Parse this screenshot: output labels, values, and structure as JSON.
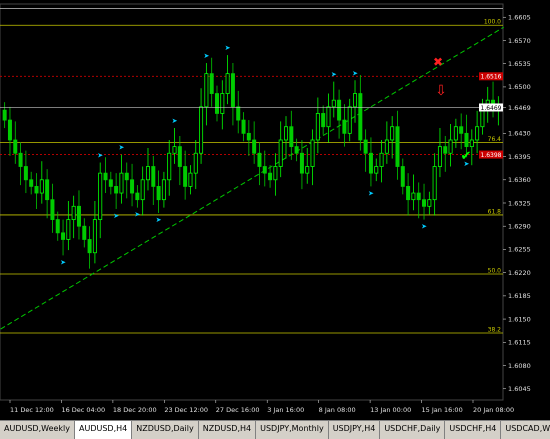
{
  "colors": {
    "background": "#000000",
    "bull": "#00ff00",
    "bear": "#00cc00",
    "fractal": "#00ccff",
    "fib": "#c8c800",
    "red_level": "#cc0000",
    "trend": "#00c800",
    "white_line": "#c8c8c8"
  },
  "chart_data": {
    "type": "candlestick",
    "symbol": "AUDUSD,H4",
    "ylim": [
      1.6028,
      1.6625
    ],
    "y_ticks": [
      "1.6605",
      "1.6570",
      "1.6535",
      "1.6500",
      "1.6469",
      "1.6430",
      "1.6395",
      "1.6360",
      "1.6325",
      "1.6290",
      "1.6255",
      "1.6220",
      "1.6185",
      "1.6150",
      "1.6115",
      "1.6080",
      "1.6045"
    ],
    "x_ticks": [
      "11 Dec 12:00",
      "16 Dec 04:00",
      "18 Dec 20:00",
      "23 Dec 12:00",
      "27 Dec 16:00",
      "3 Jan 16:00",
      "8 Jan 08:00",
      "13 Jan 00:00",
      "15 Jan 16:00",
      "20 Jan 08:00"
    ],
    "fib_levels": [
      {
        "label": "100.0",
        "price": 1.6593
      },
      {
        "label": "76.4",
        "price": 1.6416
      },
      {
        "label": "61.8",
        "price": 1.6307
      },
      {
        "label": "50.0",
        "price": 1.6218
      },
      {
        "label": "38.2",
        "price": 1.6129
      }
    ],
    "red_levels": [
      {
        "label": "1.6516",
        "price": 1.6516
      },
      {
        "label": "1.6398",
        "price": 1.6398
      }
    ],
    "current_price": {
      "label": "1.6469",
      "price": 1.6469
    },
    "top_line_price": 1.6618,
    "trendline": {
      "from": [
        0,
        1.6135
      ],
      "to": [
        94,
        1.659
      ]
    },
    "candles_close": [
      1.645,
      1.642,
      1.64,
      1.638,
      1.636,
      1.635,
      1.634,
      1.636,
      1.633,
      1.63,
      1.628,
      1.627,
      1.63,
      1.632,
      1.629,
      1.627,
      1.625,
      1.63,
      1.637,
      1.636,
      1.635,
      1.634,
      1.637,
      1.636,
      1.634,
      1.633,
      1.636,
      1.638,
      1.635,
      1.633,
      1.636,
      1.64,
      1.641,
      1.638,
      1.635,
      1.637,
      1.64,
      1.647,
      1.652,
      1.649,
      1.646,
      1.649,
      1.652,
      1.647,
      1.645,
      1.643,
      1.642,
      1.64,
      1.638,
      1.637,
      1.636,
      1.638,
      1.642,
      1.644,
      1.641,
      1.64,
      1.637,
      1.638,
      1.642,
      1.646,
      1.644,
      1.647,
      1.648,
      1.645,
      1.643,
      1.647,
      1.649,
      1.642,
      1.64,
      1.637,
      1.638,
      1.64,
      1.642,
      1.644,
      1.638,
      1.635,
      1.633,
      1.634,
      1.633,
      1.632,
      1.633,
      1.638,
      1.641,
      1.64,
      1.642,
      1.644,
      1.643,
      1.641,
      1.642,
      1.644,
      1.647,
      1.648,
      1.647,
      1.647
    ],
    "annotations": [
      {
        "type": "cross",
        "text": "✖"
      },
      {
        "type": "down-arrow",
        "text": "⇩"
      },
      {
        "type": "check",
        "text": "✔"
      }
    ]
  },
  "tabs": [
    {
      "label": "AUDUSD,Weekly",
      "active": false
    },
    {
      "label": "AUDUSD,H4",
      "active": true
    },
    {
      "label": "NZDUSD,Daily",
      "active": false
    },
    {
      "label": "NZDUSD,H4",
      "active": false
    },
    {
      "label": "USDJPY,Monthly",
      "active": false
    },
    {
      "label": "USDJPY,H4",
      "active": false
    },
    {
      "label": "USDCHF,Daily",
      "active": false
    },
    {
      "label": "USDCHF,H4",
      "active": false
    },
    {
      "label": "USDCAD,Week",
      "active": false
    }
  ]
}
